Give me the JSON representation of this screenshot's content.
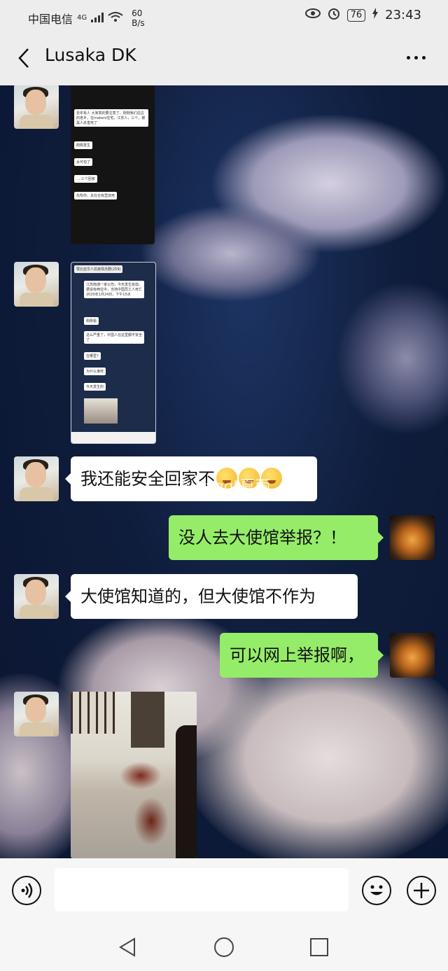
{
  "status_bar": {
    "carrier": "中国电信",
    "network": "4G",
    "speed_value": "60",
    "speed_unit": "B/s",
    "battery": "76",
    "time": "23:43"
  },
  "header": {
    "title": "Lusaka DK"
  },
  "messages": {
    "m3_text": "我还能安全回家不",
    "m4_text": "没人去大使馆举报？！",
    "m5_text": "大使馆知道的，但大使馆不作为",
    "m6_text": "可以网上举报啊，"
  },
  "watermark": "@Waggt夏雨",
  "shot1": {
    "line1": "去年有人 大家真的要注意了。刚刚我们这边的老乡，在makeni住宅，江苏人，三个，被黑人杀害死了",
    "line2": "刚刚发生",
    "line3": "太可怕了",
    "line4": "…·三个回家",
    "line5": "先吹你，关在仓库里烧死"
  },
  "shot2": {
    "group_title": "赞比亚华人抗疫情沃群(259)",
    "news": "江苏南通一家公司，今天发生抢劫，据说有两位中，当地中国员工人死亡 2020年1月24日，下午15点",
    "reply1": "刚刚看",
    "reply2": "这么严重了，中国人在这里都不安全了",
    "reply3": "在哪里?",
    "reply4": "为什么谁死",
    "reply5": "今天发生的"
  }
}
